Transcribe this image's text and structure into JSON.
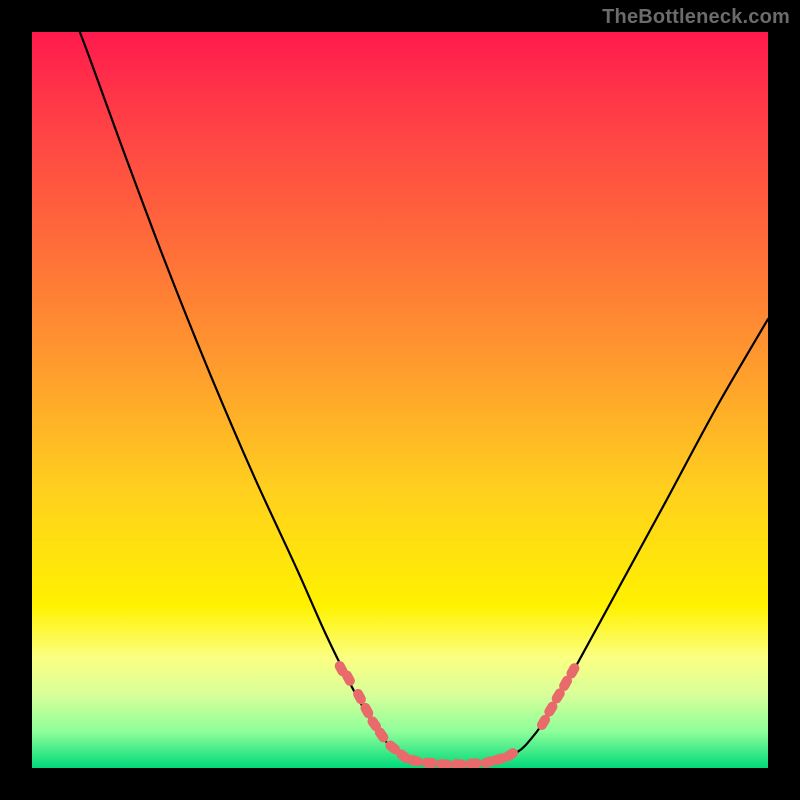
{
  "watermark": "TheBottleneck.com",
  "chart_data": {
    "type": "line",
    "title": "",
    "xlabel": "",
    "ylabel": "",
    "xlim": [
      0,
      100
    ],
    "ylim": [
      0,
      100
    ],
    "series": [
      {
        "name": "curve",
        "points": [
          {
            "x": 6.5,
            "y": 100.0
          },
          {
            "x": 8.0,
            "y": 96.0
          },
          {
            "x": 12.0,
            "y": 85.0
          },
          {
            "x": 18.0,
            "y": 69.0
          },
          {
            "x": 24.0,
            "y": 54.0
          },
          {
            "x": 30.0,
            "y": 40.0
          },
          {
            "x": 36.0,
            "y": 27.0
          },
          {
            "x": 40.0,
            "y": 18.0
          },
          {
            "x": 44.0,
            "y": 10.0
          },
          {
            "x": 47.0,
            "y": 5.0
          },
          {
            "x": 49.5,
            "y": 2.2
          },
          {
            "x": 52.0,
            "y": 1.0
          },
          {
            "x": 56.0,
            "y": 0.5
          },
          {
            "x": 60.0,
            "y": 0.5
          },
          {
            "x": 63.0,
            "y": 1.0
          },
          {
            "x": 66.0,
            "y": 2.2
          },
          {
            "x": 68.0,
            "y": 4.2
          },
          {
            "x": 70.0,
            "y": 7.0
          },
          {
            "x": 74.0,
            "y": 14.0
          },
          {
            "x": 80.0,
            "y": 25.0
          },
          {
            "x": 86.0,
            "y": 36.0
          },
          {
            "x": 93.0,
            "y": 49.0
          },
          {
            "x": 100.0,
            "y": 61.0
          }
        ]
      }
    ],
    "markers": [
      {
        "x": 42.0,
        "y": 13.5
      },
      {
        "x": 43.0,
        "y": 12.2
      },
      {
        "x": 44.5,
        "y": 9.7
      },
      {
        "x": 45.5,
        "y": 7.8
      },
      {
        "x": 46.5,
        "y": 6.0
      },
      {
        "x": 47.5,
        "y": 4.5
      },
      {
        "x": 49.0,
        "y": 2.8
      },
      {
        "x": 50.5,
        "y": 1.6
      },
      {
        "x": 52.0,
        "y": 1.0
      },
      {
        "x": 54.0,
        "y": 0.7
      },
      {
        "x": 56.0,
        "y": 0.5
      },
      {
        "x": 58.0,
        "y": 0.5
      },
      {
        "x": 60.0,
        "y": 0.6
      },
      {
        "x": 62.0,
        "y": 0.8
      },
      {
        "x": 63.5,
        "y": 1.2
      },
      {
        "x": 65.0,
        "y": 1.8
      },
      {
        "x": 69.5,
        "y": 6.2
      },
      {
        "x": 70.5,
        "y": 8.0
      },
      {
        "x": 71.5,
        "y": 9.8
      },
      {
        "x": 72.5,
        "y": 11.5
      },
      {
        "x": 73.5,
        "y": 13.2
      }
    ],
    "marker_color": "#e86a6a",
    "curve_color": "#000000"
  }
}
